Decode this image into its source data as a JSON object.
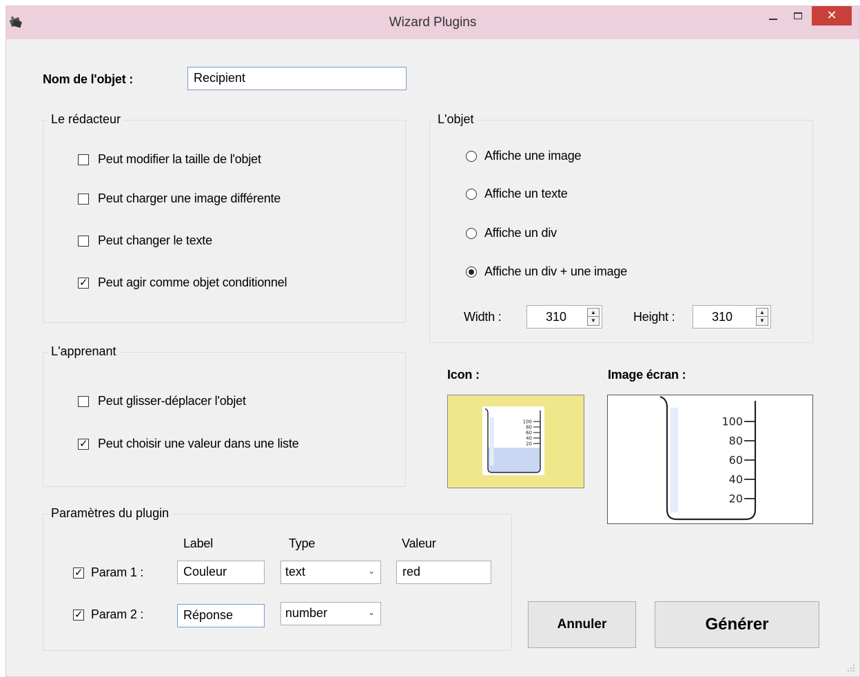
{
  "window": {
    "title": "Wizard Plugins",
    "app_icon": "app-icon",
    "minimize_icon": "minimize-icon",
    "maximize_icon": "maximize-icon",
    "close_glyph": "✕",
    "close_color": "#c8413a"
  },
  "object_name": {
    "label": "Nom de l'objet :",
    "value": "Recipient"
  },
  "redacteur": {
    "title": "Le rédacteur",
    "options": [
      {
        "label": "Peut modifier la taille de l'objet",
        "checked": false
      },
      {
        "label": "Peut charger une image différente",
        "checked": false
      },
      {
        "label": "Peut changer le texte",
        "checked": false
      },
      {
        "label": "Peut agir comme objet conditionnel",
        "checked": true
      }
    ]
  },
  "objet": {
    "title": "L'objet",
    "options": [
      {
        "label": "Affiche une image",
        "selected": false
      },
      {
        "label": "Affiche un texte",
        "selected": false
      },
      {
        "label": "Affiche un div",
        "selected": false
      },
      {
        "label": "Affiche un div + une image",
        "selected": true
      }
    ],
    "width_label": "Width :",
    "width_value": "310",
    "height_label": "Height :",
    "height_value": "310"
  },
  "apprenant": {
    "title": "L'apprenant",
    "options": [
      {
        "label": "Peut glisser-déplacer l'objet",
        "checked": false
      },
      {
        "label": "Peut choisir une valeur dans une liste",
        "checked": true
      }
    ]
  },
  "icon_label": "Icon :",
  "image_label": "Image écran :",
  "beaker": {
    "ticks": [
      "100",
      "80",
      "60",
      "40",
      "20"
    ],
    "fill_fraction": 0.4,
    "liquid_color": "#c9d7f2",
    "icon_bg": "#f0e68c"
  },
  "params": {
    "title": "Paramètres du plugin",
    "col_label": "Label",
    "col_type": "Type",
    "col_value": "Valeur",
    "rows": [
      {
        "name": "Param 1 :",
        "checked": true,
        "label": "Couleur",
        "type": "text",
        "value": "red"
      },
      {
        "name": "Param 2 :",
        "checked": true,
        "label": "Réponse",
        "type": "number",
        "value": ""
      }
    ]
  },
  "buttons": {
    "cancel": "Annuler",
    "generate": "Générer"
  }
}
